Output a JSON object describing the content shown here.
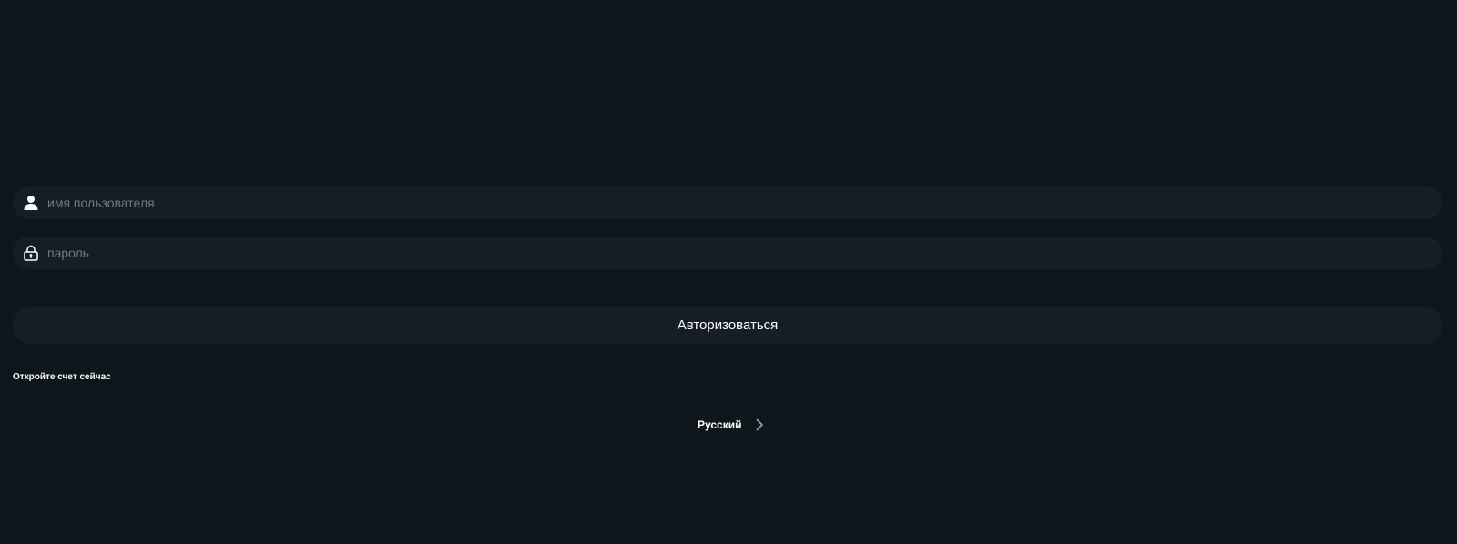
{
  "login_form": {
    "username": {
      "placeholder": "имя пользователя",
      "value": "",
      "icon": "user-icon"
    },
    "password": {
      "placeholder": "пароль",
      "value": "",
      "icon": "lock-icon"
    },
    "submit_label": "Авторизоваться"
  },
  "register_link": "Откройте счет сейчас",
  "language": {
    "selected": "Русский",
    "icon": "chevron-right-icon"
  },
  "colors": {
    "background": "#0d161b",
    "field_background": "#151e26",
    "text": "#ffffff",
    "placeholder": "#707a83"
  }
}
